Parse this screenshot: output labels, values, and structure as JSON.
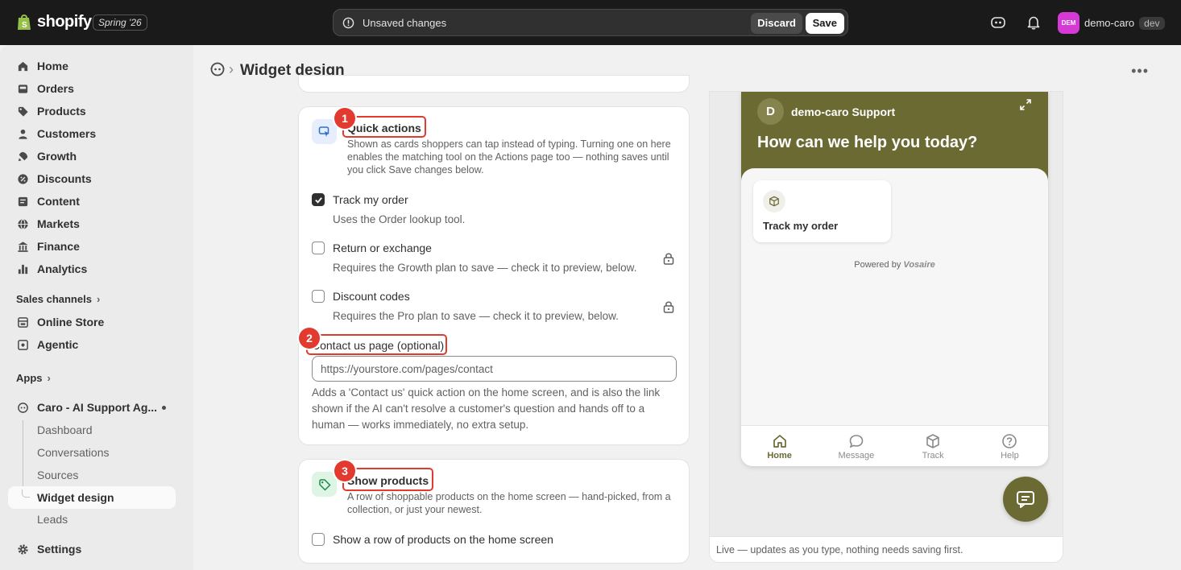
{
  "topbar": {
    "brand": "shopify",
    "edition": "Spring '26",
    "unsaved_text": "Unsaved changes",
    "discard_label": "Discard",
    "save_label": "Save",
    "store_avatar": "DEM",
    "store_name": "demo-caro",
    "store_badge": "dev"
  },
  "sidebar": {
    "items": [
      {
        "label": "Home",
        "icon": "home-icon"
      },
      {
        "label": "Orders",
        "icon": "inbox-icon"
      },
      {
        "label": "Products",
        "icon": "tag-icon"
      },
      {
        "label": "Customers",
        "icon": "person-icon"
      },
      {
        "label": "Growth",
        "icon": "growth-icon"
      },
      {
        "label": "Discounts",
        "icon": "discount-icon"
      },
      {
        "label": "Content",
        "icon": "content-icon"
      },
      {
        "label": "Markets",
        "icon": "globe-icon"
      },
      {
        "label": "Finance",
        "icon": "bank-icon"
      },
      {
        "label": "Analytics",
        "icon": "bar-chart-icon"
      }
    ],
    "sales_channels_label": "Sales channels",
    "channels": [
      {
        "label": "Online Store",
        "icon": "store-icon"
      },
      {
        "label": "Agentic",
        "icon": "agentic-icon"
      }
    ],
    "apps_label": "Apps",
    "app_name": "Caro - AI Support Ag...",
    "app_subitems": [
      "Dashboard",
      "Conversations",
      "Sources",
      "Widget design",
      "Leads"
    ],
    "settings_label": "Settings"
  },
  "header": {
    "title": "Widget design"
  },
  "quick_actions": {
    "title": "Quick actions",
    "description": "Shown as cards shoppers can tap instead of typing. Turning one on here enables the matching tool on the Actions page too — nothing saves until you click Save changes below.",
    "options": [
      {
        "label": "Track my order",
        "help": "Uses the Order lookup tool.",
        "checked": true,
        "locked": false
      },
      {
        "label": "Return or exchange",
        "help": "Requires the Growth plan to save — check it to preview, below.",
        "checked": false,
        "locked": true
      },
      {
        "label": "Discount codes",
        "help": "Requires the Pro plan to save — check it to preview, below.",
        "checked": false,
        "locked": true
      }
    ],
    "contact_label": "Contact us page (optional)",
    "contact_placeholder": "https://yourstore.com/pages/contact",
    "contact_help": "Adds a 'Contact us' quick action on the home screen, and is also the link shown if the AI can't resolve a customer's question and hands off to a human — works immediately, no extra setup."
  },
  "show_products": {
    "title": "Show products",
    "description": "A row of shoppable products on the home screen — hand-picked, from a collection, or just your newest.",
    "option_label": "Show a row of products on the home screen"
  },
  "annotations": [
    "1",
    "2",
    "3"
  ],
  "preview": {
    "avatar_letter": "D",
    "brand_name": "demo-caro Support",
    "greeting": "How can we help you today?",
    "action_label": "Track my order",
    "powered_by": "Powered by",
    "powered_brand": "Vosaire",
    "tabs": [
      {
        "label": "Home",
        "icon": "home-icon"
      },
      {
        "label": "Message",
        "icon": "chat-bubble-icon"
      },
      {
        "label": "Track",
        "icon": "box-icon"
      },
      {
        "label": "Help",
        "icon": "help-icon"
      }
    ],
    "footer_text": "Live — updates as you type, nothing needs saving first.",
    "accent_color": "#6b6a33"
  }
}
